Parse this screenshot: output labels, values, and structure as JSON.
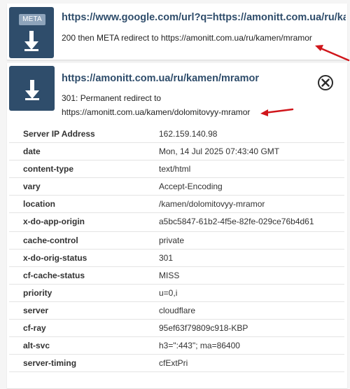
{
  "redirects": [
    {
      "badge": "META",
      "url": "https://www.google.com/url?q=https://amonitt.com.ua/ru/kamen/mramor",
      "description": "200 then META redirect to https://amonitt.com.ua/ru/kamen/mramor",
      "icon": "down-arrow-icon"
    },
    {
      "url": "https://amonitt.com.ua/ru/kamen/mramor",
      "description_line1": "301: Permanent redirect to",
      "description_line2": "https://amonitt.com.ua/kamen/dolomitovyy-mramor",
      "icon": "down-arrow-icon",
      "close_icon": "close-circle-icon",
      "headers": [
        {
          "key": "Server IP Address",
          "value": "162.159.140.98"
        },
        {
          "key": "date",
          "value": "Mon, 14 Jul 2025 07:43:40 GMT"
        },
        {
          "key": "content-type",
          "value": "text/html"
        },
        {
          "key": "vary",
          "value": "Accept-Encoding"
        },
        {
          "key": "location",
          "value": "/kamen/dolomitovyy-mramor"
        },
        {
          "key": "x-do-app-origin",
          "value": "a5bc5847-61b2-4f5e-82fe-029ce76b4d61"
        },
        {
          "key": "cache-control",
          "value": "private"
        },
        {
          "key": "x-do-orig-status",
          "value": "301"
        },
        {
          "key": "cf-cache-status",
          "value": "MISS"
        },
        {
          "key": "priority",
          "value": "u=0,i"
        },
        {
          "key": "server",
          "value": "cloudflare"
        },
        {
          "key": "cf-ray",
          "value": "95ef63f79809c918-KBP"
        },
        {
          "key": "alt-svc",
          "value": "h3=\":443\"; ma=86400"
        },
        {
          "key": "server-timing",
          "value": "cfExtPri"
        }
      ]
    }
  ],
  "colors": {
    "icon_bg": "#2f4d6b",
    "badge_bg": "#8ea4bb",
    "url_text": "#2f4d6b",
    "annotation_arrow": "#d0161b"
  }
}
